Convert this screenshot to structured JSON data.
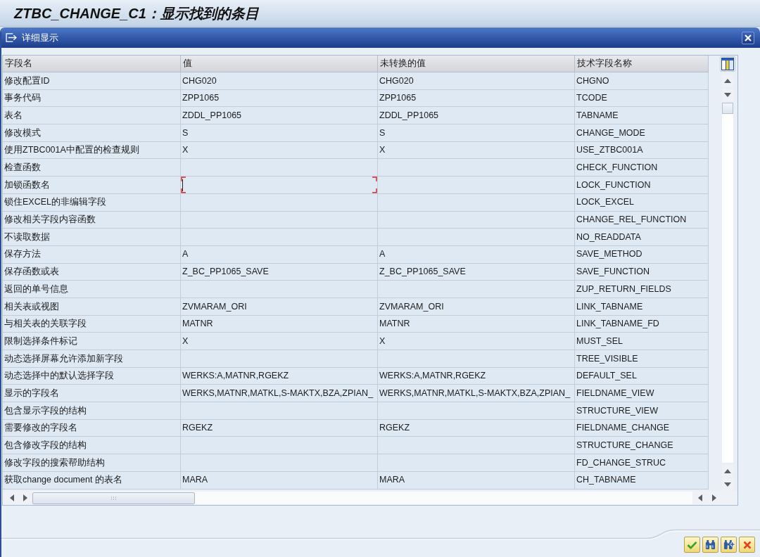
{
  "window": {
    "title": "ZTBC_CHANGE_C1：显示找到的条目"
  },
  "dialog": {
    "title": "详细显示"
  },
  "table": {
    "columns": [
      "字段名",
      "值",
      "未转换的值",
      "技术字段名称"
    ],
    "rows": [
      {
        "field": "修改配置ID",
        "value": "CHG020",
        "unconverted_value": "CHG020",
        "technical_name": "CHGNO",
        "focused": false
      },
      {
        "field": "事务代码",
        "value": "ZPP1065",
        "unconverted_value": "ZPP1065",
        "technical_name": "TCODE",
        "focused": false
      },
      {
        "field": "表名",
        "value": "ZDDL_PP1065",
        "unconverted_value": "ZDDL_PP1065",
        "technical_name": "TABNAME",
        "focused": false
      },
      {
        "field": "修改模式",
        "value": "S",
        "unconverted_value": "S",
        "technical_name": "CHANGE_MODE",
        "focused": false
      },
      {
        "field": "使用ZTBC001A中配置的检查规则",
        "value": "X",
        "unconverted_value": "X",
        "technical_name": "USE_ZTBC001A",
        "focused": false
      },
      {
        "field": "检查函数",
        "technical_name": "CHECK_FUNCTION",
        "focused": false
      },
      {
        "field": "加锁函数名",
        "technical_name": "LOCK_FUNCTION",
        "focused": true
      },
      {
        "field": "锁住EXCEL的非编辑字段",
        "technical_name": "LOCK_EXCEL",
        "focused": false
      },
      {
        "field": "修改相关字段内容函数",
        "technical_name": "CHANGE_REL_FUNCTION",
        "focused": false
      },
      {
        "field": "不读取数据",
        "technical_name": "NO_READDATA",
        "focused": false
      },
      {
        "field": "保存方法",
        "value": "A",
        "unconverted_value": "A",
        "technical_name": "SAVE_METHOD",
        "focused": false
      },
      {
        "field": "保存函数或表",
        "value": "Z_BC_PP1065_SAVE",
        "unconverted_value": "Z_BC_PP1065_SAVE",
        "technical_name": "SAVE_FUNCTION",
        "focused": false
      },
      {
        "field": "返回的单号信息",
        "technical_name": "ZUP_RETURN_FIELDS",
        "focused": false
      },
      {
        "field": "相关表或视图",
        "value": "ZVMARAM_ORI",
        "unconverted_value": "ZVMARAM_ORI",
        "technical_name": "LINK_TABNAME",
        "focused": false
      },
      {
        "field": "与相关表的关联字段",
        "value": "MATNR",
        "unconverted_value": "MATNR",
        "technical_name": "LINK_TABNAME_FD",
        "focused": false
      },
      {
        "field": "限制选择条件标记",
        "value": "X",
        "unconverted_value": "X",
        "technical_name": "MUST_SEL",
        "focused": false
      },
      {
        "field": "动态选择屏幕允许添加新字段",
        "technical_name": "TREE_VISIBLE",
        "focused": false
      },
      {
        "field": "动态选择中的默认选择字段",
        "value": "WERKS:A,MATNR,RGEKZ",
        "unconverted_value": "WERKS:A,MATNR,RGEKZ",
        "technical_name": "DEFAULT_SEL",
        "focused": false
      },
      {
        "field": "显示的字段名",
        "value": "WERKS,MATNR,MATKL,S-MAKTX,BZA,ZPIAN_",
        "unconverted_value": "WERKS,MATNR,MATKL,S-MAKTX,BZA,ZPIAN_",
        "technical_name": "FIELDNAME_VIEW",
        "focused": false
      },
      {
        "field": "包含显示字段的结构",
        "technical_name": "STRUCTURE_VIEW",
        "focused": false
      },
      {
        "field": "需要修改的字段名",
        "value": "RGEKZ",
        "unconverted_value": "RGEKZ",
        "technical_name": "FIELDNAME_CHANGE",
        "focused": false
      },
      {
        "field": "包含修改字段的结构",
        "technical_name": "STRUCTURE_CHANGE",
        "focused": false
      },
      {
        "field": "修改字段的搜索帮助结构",
        "technical_name": "FD_CHANGE_STRUC",
        "focused": false
      },
      {
        "field": "获取change document 的表名",
        "value": "MARA",
        "unconverted_value": "MARA",
        "technical_name": "CH_TABNAME",
        "focused": false
      }
    ]
  }
}
